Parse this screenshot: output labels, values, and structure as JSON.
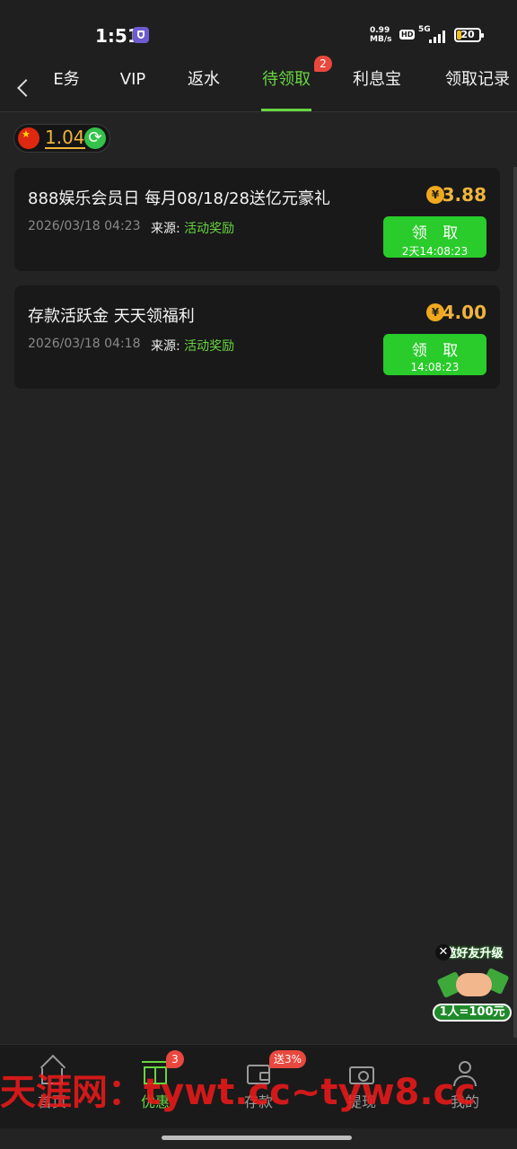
{
  "status_bar": {
    "time": "1:51",
    "net_speed_value": "0.99",
    "net_speed_unit": "MB/s",
    "hd": "HD",
    "network": "5G",
    "battery": "20",
    "battery_level": 0.2
  },
  "tabs": [
    {
      "label": "E务"
    },
    {
      "label": "VIP"
    },
    {
      "label": "返水"
    },
    {
      "label": "待领取",
      "badge": "2",
      "active": true
    },
    {
      "label": "利息宝"
    },
    {
      "label": "领取记录"
    }
  ],
  "balance": {
    "value": "1.04",
    "flag_icon": "china-flag-icon",
    "refresh_icon": "refresh-icon"
  },
  "rewards": [
    {
      "title": "888娱乐会员日 每月08/18/28送亿元豪礼",
      "date": "2026/03/18 04:23",
      "source_label": "来源:",
      "source_value": "活动奖励",
      "amount": "3.88",
      "currency_icon": "yen",
      "button_label": "领 取",
      "countdown": "2天14:08:23"
    },
    {
      "title": "存款活跃金 天天领福利",
      "date": "2026/03/18 04:18",
      "source_label": "来源:",
      "source_value": "活动奖励",
      "amount": "4.00",
      "currency_icon": "yen",
      "button_label": "领 取",
      "countdown": "14:08:23"
    }
  ],
  "currency_symbol": "¥",
  "float_promo": {
    "title": "邀好友升级",
    "reward": "1人=100元",
    "close": "✕"
  },
  "bottom_nav": [
    {
      "label": "首页",
      "icon": "home-icon"
    },
    {
      "label": "优惠",
      "icon": "gift-icon",
      "badge": "3",
      "active": true
    },
    {
      "label": "存款",
      "icon": "wallet-icon",
      "badge": "送3%"
    },
    {
      "label": "提现",
      "icon": "withdraw-icon"
    },
    {
      "label": "我的",
      "icon": "user-icon"
    }
  ],
  "watermark": "天涯网：tywt.cc~tyw8.cc",
  "colors": {
    "background": "#232323",
    "accent_green": "#67d640",
    "button_green": "#29cc2a",
    "gold": "#f0b43c",
    "badge_red": "#e8483e",
    "watermark_red": "#eb1919"
  }
}
